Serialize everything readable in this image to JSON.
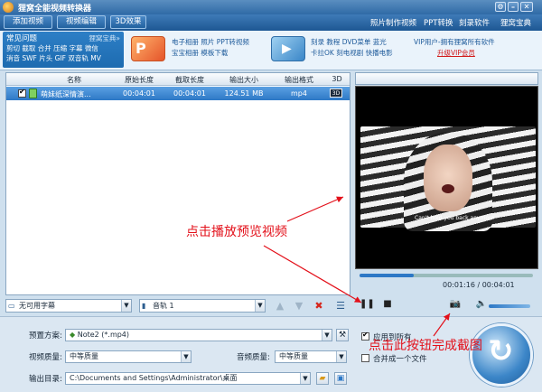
{
  "window": {
    "title": "狸窝全能视频转换器"
  },
  "toolbar": {
    "add_video": "添加视频",
    "edit_video": "视频编辑",
    "effect_3d": "3D效果",
    "links": [
      "照片制作视频",
      "PPT转换",
      "刻录软件",
      "狸窝宝典"
    ]
  },
  "banner": {
    "faq_title": "常见问题",
    "faq_brand": "狸窝宝典»",
    "faq_row1": "剪切 截取 合并 压缩 字幕 微信",
    "faq_row2": "消音 SWF 片头 GIF 双音轨 MV",
    "ad1_line1": "电子相册 照片 PPT转视频",
    "ad1_line2": "宝宝相册 模板下载",
    "ad2_line1": "刻录 教程 DVD菜单 蓝光",
    "ad2_line2": "卡拉OK 刻电视剧 快播电影",
    "vip_line1": "VIP用户-拥有狸窝所有软件",
    "vip_line2": "升级VIP会员"
  },
  "filelist": {
    "columns": [
      "名称",
      "原始长度",
      "截取长度",
      "输出大小",
      "输出格式",
      "3D"
    ],
    "rows": [
      {
        "name": "萌妹纸深情演...",
        "orig": "00:04:01",
        "cut": "00:04:01",
        "size": "124.51 MB",
        "format": "mp4",
        "badge": "3D"
      }
    ]
  },
  "listbar": {
    "subtitle": "无可用字幕",
    "audio": "音轨 1"
  },
  "player": {
    "time": "00:01:16 / 00:04:01",
    "progress": 0.31,
    "volume": 0.85
  },
  "video": {
    "caption": "Can't hold you back anymore"
  },
  "settings": {
    "preset_label": "预置方案:",
    "preset_value": "Note2 (*.mp4)",
    "vq_label": "视频质量:",
    "vq_value": "中等质量",
    "aq_label": "音频质量:",
    "aq_value": "中等质量",
    "out_label": "输出目录:",
    "out_value": "C:\\Documents and Settings\\Administrator\\桌面",
    "apply_all": "应用到所有",
    "merge": "合并成一个文件"
  },
  "annotations": {
    "play": "点击播放预览视频",
    "snapshot": "点击此按钮完成截图"
  }
}
